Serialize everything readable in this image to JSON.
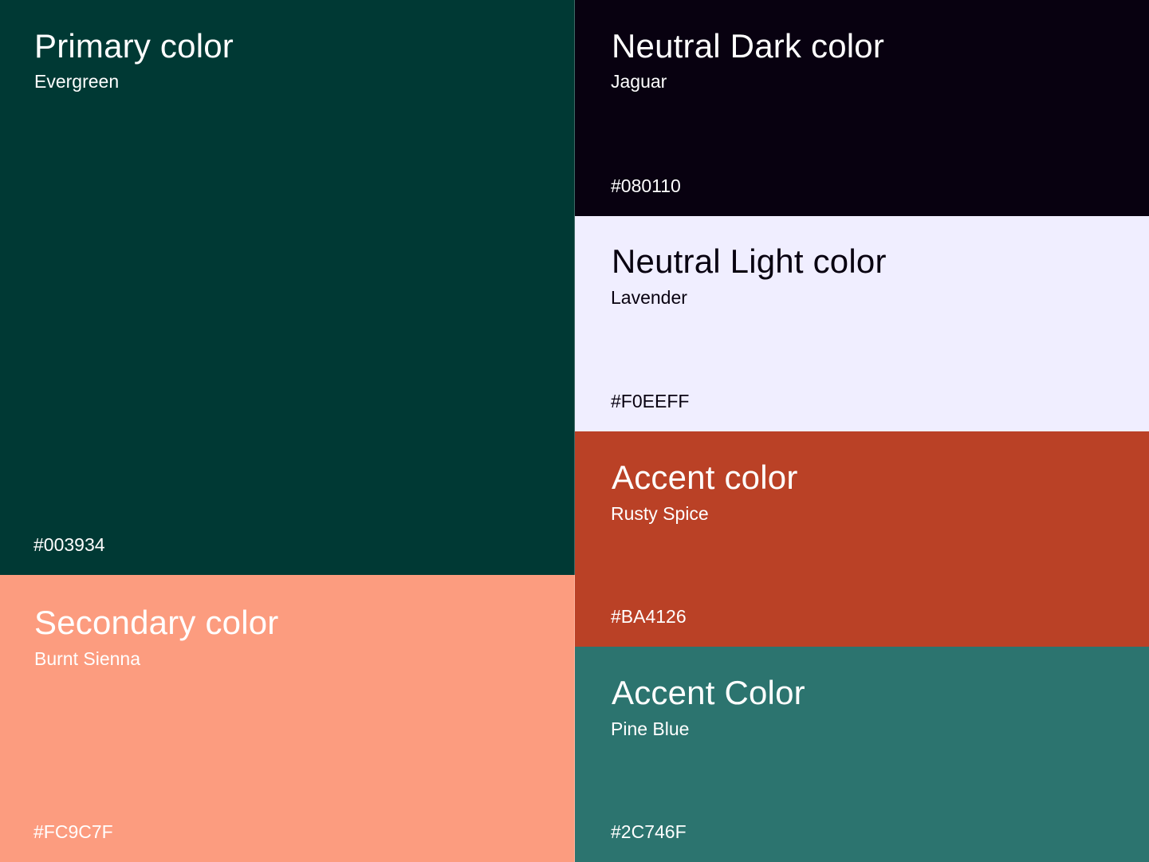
{
  "swatches": {
    "primary": {
      "title": "Primary color",
      "name": "Evergreen",
      "hex": "#003934",
      "background": "#003934",
      "text_color": "#FFFFFF"
    },
    "secondary": {
      "title": "Secondary color",
      "name": "Burnt Sienna",
      "hex": "#FC9C7F",
      "background": "#FC9C7F",
      "text_color": "#FFFFFF"
    },
    "neutral_dark": {
      "title": "Neutral Dark color",
      "name": "Jaguar",
      "hex": "#080110",
      "background": "#080110",
      "text_color": "#FFFFFF"
    },
    "neutral_light": {
      "title": "Neutral Light color",
      "name": "Lavender",
      "hex": "#F0EEFF",
      "background": "#F0EEFF",
      "text_color": "#080110"
    },
    "accent_1": {
      "title": "Accent color",
      "name": "Rusty Spice",
      "hex": "#BA4126",
      "background": "#BA4126",
      "text_color": "#FFFFFF"
    },
    "accent_2": {
      "title": "Accent Color",
      "name": "Pine Blue",
      "hex": "#2C746F",
      "background": "#2C746F",
      "text_color": "#FFFFFF"
    }
  }
}
